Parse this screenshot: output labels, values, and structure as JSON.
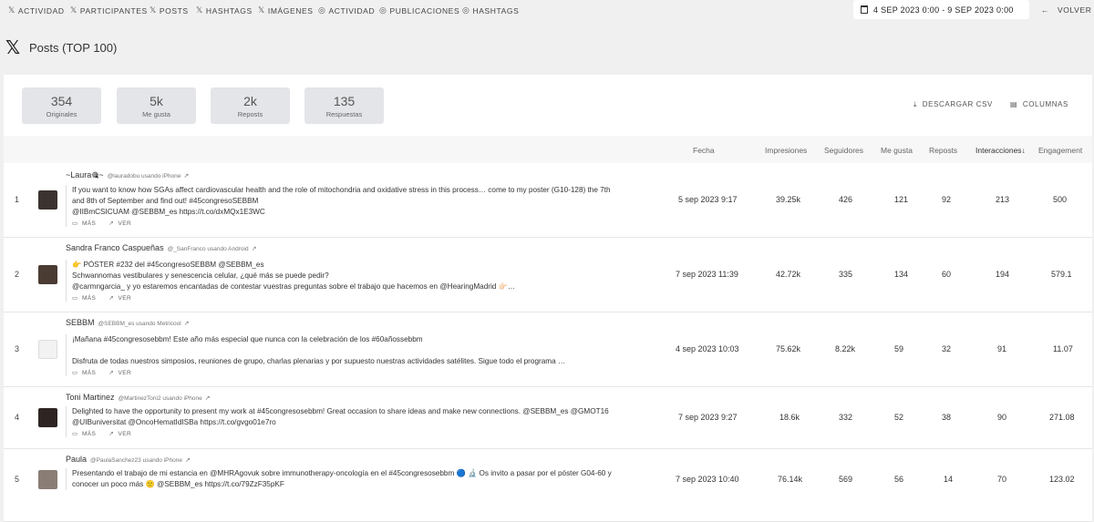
{
  "nav": {
    "items": [
      {
        "icon": "x-logo-icon",
        "label": "ACTIVIDAD"
      },
      {
        "icon": "x-logo-icon",
        "label": "PARTICIPANTES"
      },
      {
        "icon": "x-logo-icon",
        "label": "POSTS"
      },
      {
        "icon": "x-logo-icon",
        "label": "HASHTAGS"
      },
      {
        "icon": "x-logo-icon",
        "label": "IMÁGENES"
      },
      {
        "icon": "instagram-icon",
        "label": "ACTIVIDAD"
      },
      {
        "icon": "instagram-icon",
        "label": "PUBLICACIONES"
      },
      {
        "icon": "instagram-icon",
        "label": "HASHTAGS"
      }
    ],
    "date_range": "4 SEP 2023 0:00  -  9 SEP 2023 0:00",
    "back_label": "VOLVER"
  },
  "page": {
    "title": "Posts (TOP 100)"
  },
  "summary": {
    "stats": [
      {
        "value": "354",
        "label": "Originales"
      },
      {
        "value": "5k",
        "label": "Me gusta"
      },
      {
        "value": "2k",
        "label": "Reposts"
      },
      {
        "value": "135",
        "label": "Respuestas"
      }
    ],
    "download_label": "DESCARGAR CSV",
    "columns_label": "COLUMNAS"
  },
  "table": {
    "headers": {
      "fecha": "Fecha",
      "impresiones": "Impresiones",
      "seguidores": "Seguidores",
      "megusta": "Me gusta",
      "reposts": "Reposts",
      "interacciones": "Interacciones",
      "engagement": "Engagement"
    },
    "sort_indicator": "↓",
    "action_more": "MÁS",
    "action_view": "VER",
    "rows": [
      {
        "rank": "1",
        "name": "~Laura🎕~",
        "handle": "@lauradobu usando iPhone",
        "lines": [
          "If you want to know how SGAs affect cardiovascular health and the role of mitochondria and oxidative stress in this process… come to my poster (G10-128) the 7th",
          "and 8th of September and find out! #45congresoSEBBM",
          "@IIBmCSICUAM @SEBBM_es https://t.co/dxMQx1E3WC"
        ],
        "fecha": "5 sep 2023 9:17",
        "impresiones": "39.25k",
        "seguidores": "426",
        "megusta": "121",
        "reposts": "92",
        "interacciones": "213",
        "engagement": "500"
      },
      {
        "rank": "2",
        "name": "Sandra Franco Caspueñas",
        "handle": "@_SanFranco usando Android",
        "lines": [
          "👉 PÓSTER #232 del #45congresoSEBBM @SEBBM_es",
          "Schwannomas vestibulares y senescencia celular, ¿qué más se puede pedir?",
          "@carmngarcia_ y yo estaremos encantadas de contestar vuestras preguntas sobre el trabajo que hacemos en @HearingMadrid 👉🏻…"
        ],
        "fecha": "7 sep 2023 11:39",
        "impresiones": "42.72k",
        "seguidores": "335",
        "megusta": "134",
        "reposts": "60",
        "interacciones": "194",
        "engagement": "579.1"
      },
      {
        "rank": "3",
        "name": "SEBBM",
        "handle": "@SEBBM_es usando Metricool",
        "lines": [
          "¡Mañana #45congresosebbm!  Este año más especial que nunca con la celebración de los #60añossebbm",
          "",
          "Disfruta de todas nuestros simposios, reuniones de grupo, charlas plenarias y por supuesto nuestras actividades satélites. Sigue todo el programa …"
        ],
        "fecha": "4 sep 2023 10:03",
        "impresiones": "75.62k",
        "seguidores": "8.22k",
        "megusta": "59",
        "reposts": "32",
        "interacciones": "91",
        "engagement": "11.07"
      },
      {
        "rank": "4",
        "name": "Toni Martinez",
        "handle": "@MartinezToni2 usando iPhone",
        "lines": [
          "Delighted to have the opportunity to present my work at #45congresosebbm! Great occasion to share ideas and make new connections. @SEBBM_es @GMOT16",
          "@UIBuniversitat @OncoHematIdISBa https://t.co/gvgo01e7ro"
        ],
        "fecha": "7 sep 2023 9:27",
        "impresiones": "18.6k",
        "seguidores": "332",
        "megusta": "52",
        "reposts": "38",
        "interacciones": "90",
        "engagement": "271.08"
      },
      {
        "rank": "5",
        "name": "Paula",
        "handle": "@PaulaSanchez23 usando iPhone",
        "lines": [
          "Presentando el trabajo de mi estancia en @MHRAgovuk sobre immunotherapy-oncología en el #45congresosebbm 🔵 🔬 Os invito a pasar por el póster G04-60 y",
          "conocer un poco más 🙂 @SEBBM_es https://t.co/79ZzF35pKF"
        ],
        "fecha": "7 sep 2023 10:40",
        "impresiones": "76.14k",
        "seguidores": "569",
        "megusta": "56",
        "reposts": "14",
        "interacciones": "70",
        "engagement": "123.02"
      }
    ]
  }
}
